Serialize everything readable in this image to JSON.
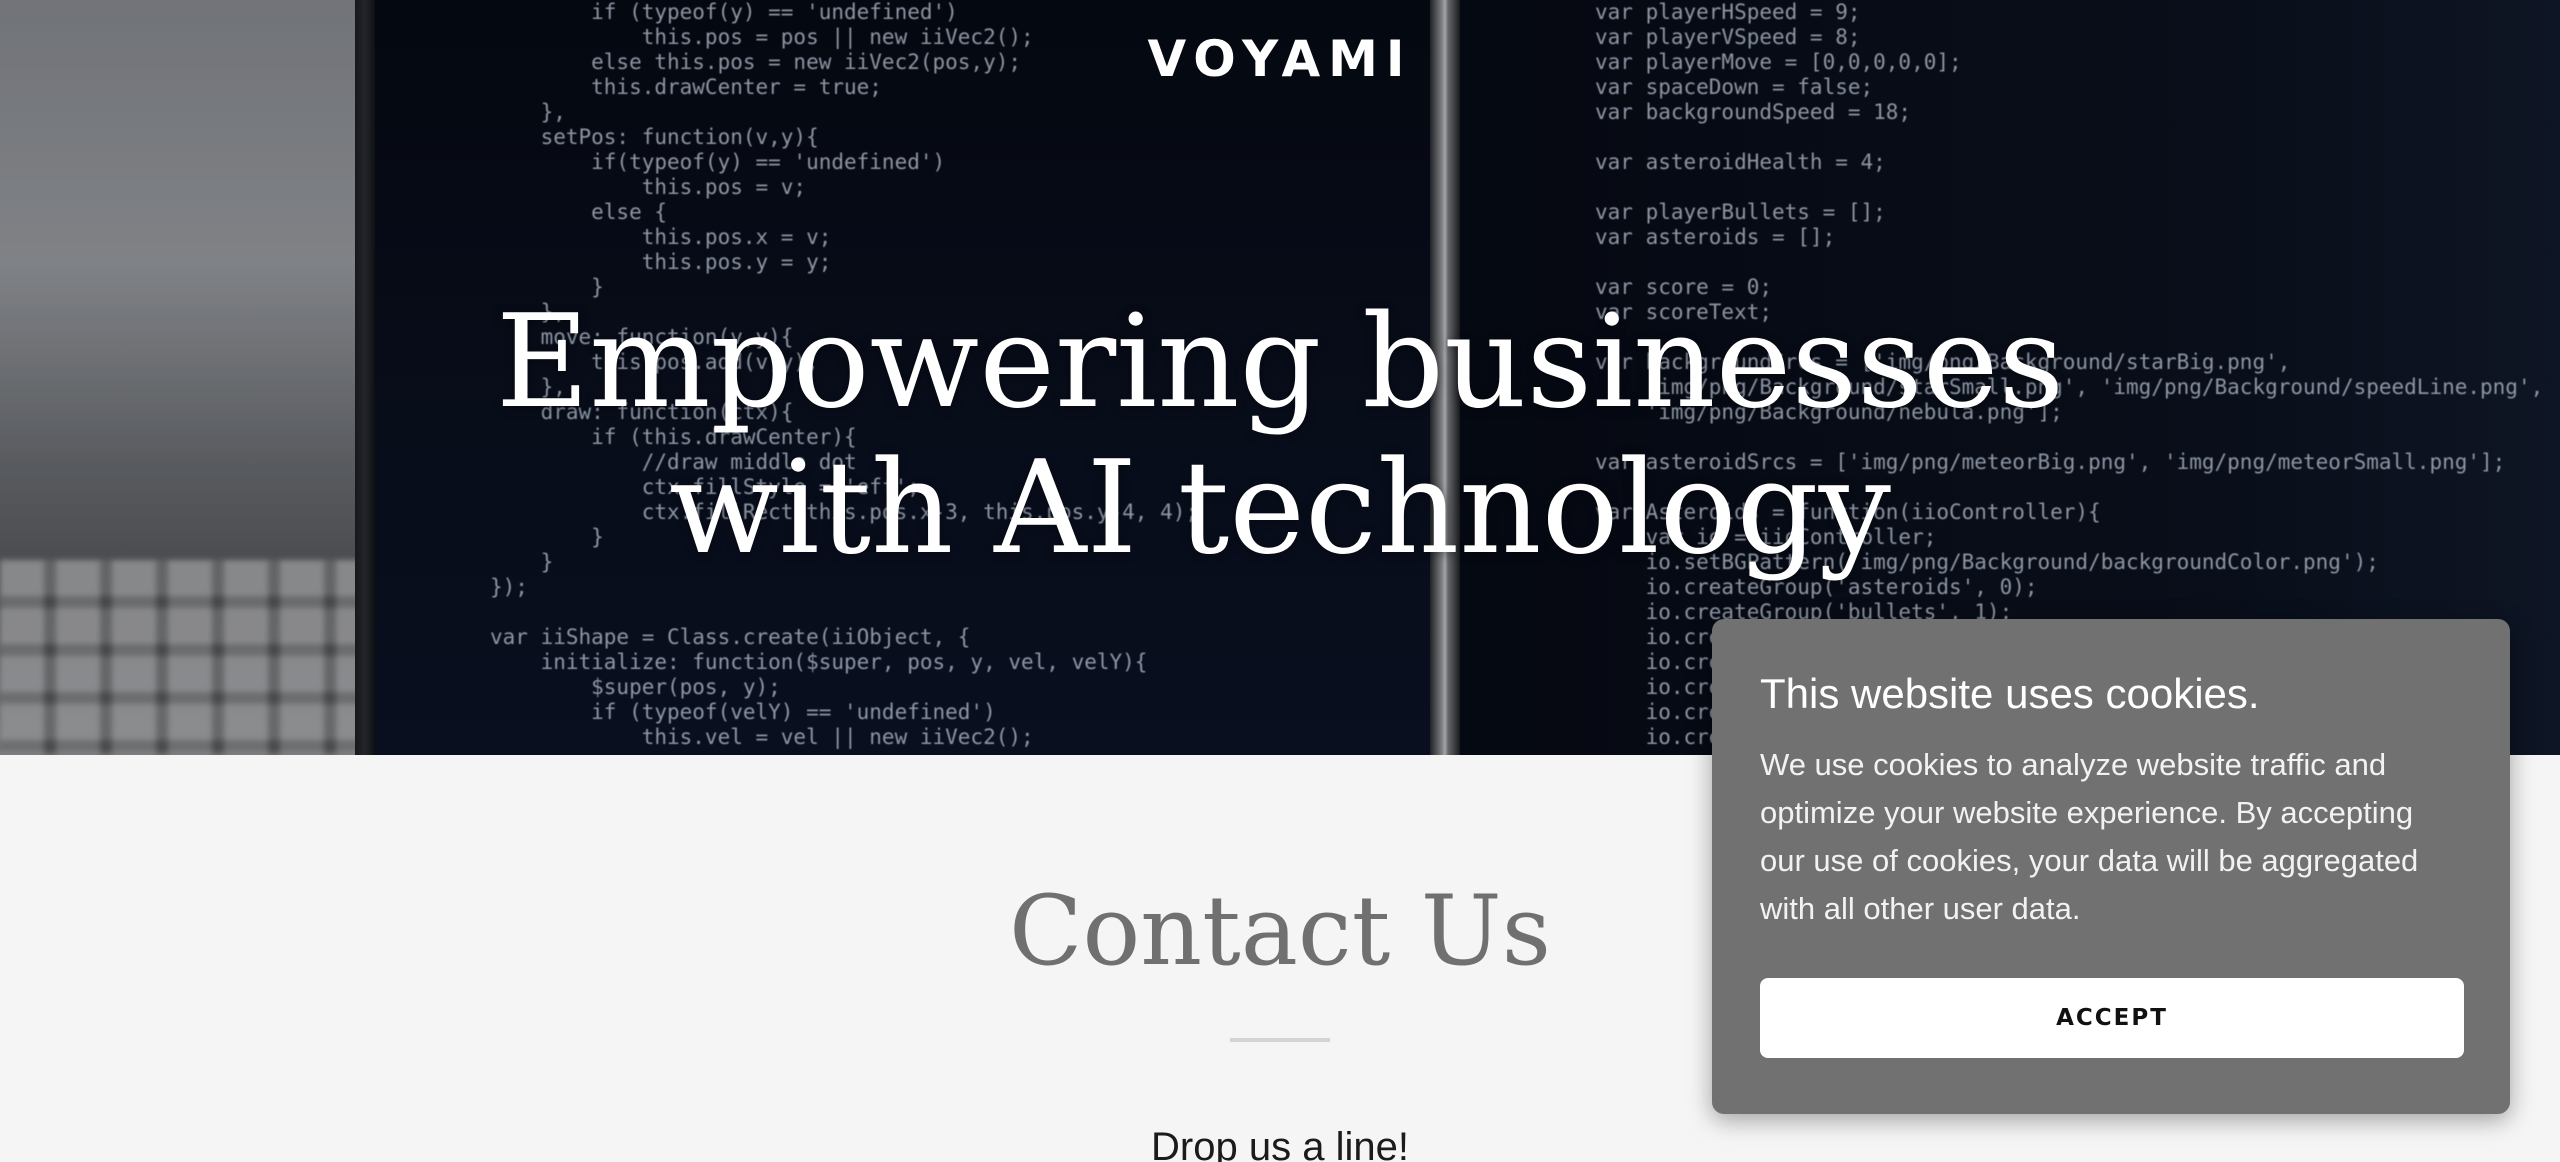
{
  "header": {
    "brand": "VOYAMI"
  },
  "hero": {
    "title_line1": "Empowering businesses",
    "title_line2": "with AI technology",
    "code_left": "        if (typeof(y) == 'undefined')\n            this.pos = pos || new iiVec2();\n        else this.pos = new iiVec2(pos,y);\n        this.drawCenter = true;\n    },\n    setPos: function(v,y){\n        if(typeof(y) == 'undefined')\n            this.pos = v;\n        else {\n            this.pos.x = v;\n            this.pos.y = y;\n        }\n    },\n    move: function(v,y){\n        this.pos.add(v,y);\n    },\n    draw: function(ctx){\n        if (this.drawCenter){\n            //draw middle dot\n            ctx.fillStyle = 'eff';\n            ctx.fillRect(this.pos.x-3, this.pos.y-4, 4);\n        }\n    }\n});\n\nvar iiShape = Class.create(iiObject, {\n    initialize: function($super, pos, y, vel, velY){\n        $super(pos, y);\n        if (typeof(velY) == 'undefined')\n            this.vel = vel || new iiVec2();",
    "code_right": "var playerHSpeed = 9;\nvar playerVSpeed = 8;\nvar playerMove = [0,0,0,0,0];\nvar spaceDown = false;\nvar backgroundSpeed = 18;\n\nvar asteroidHealth = 4;\n\nvar playerBullets = [];\nvar asteroids = [];\n\nvar score = 0;\nvar scoreText;\n\nvar backgroundSrcs = ['img/png/Background/starBig.png',\n    'img/png/Background/starSmall.png', 'img/png/Background/speedLine.png',\n    'img/png/Background/nebula.png'];\n\nvar asteroidSrcs = ['img/png/meteorBig.png', 'img/png/meteorSmall.png'];\n\nvar Asteroids = function(iioController){\n    var io = iioController;\n    io.setBGPattern('img/png/Background/backgroundColor.png');\n    io.createGroup('asteroids', 0);\n    io.createGroup('bullets', 1);\n    io.createGroup('player', 2);\n    io.createGroup('fx', 3);\n    io.createGroup('bg', -1);\n    io.createGroup('hud', 4);\n    io.createGroup('ui', 5);"
  },
  "contact": {
    "title": "Contact Us",
    "subtitle": "Drop us a line!"
  },
  "cookie_banner": {
    "title": "This website uses cookies.",
    "body": "We use cookies to analyze website traffic and optimize your website experience. By accepting our use of cookies, your data will be aggregated with all other user data.",
    "accept_label": "ACCEPT"
  }
}
